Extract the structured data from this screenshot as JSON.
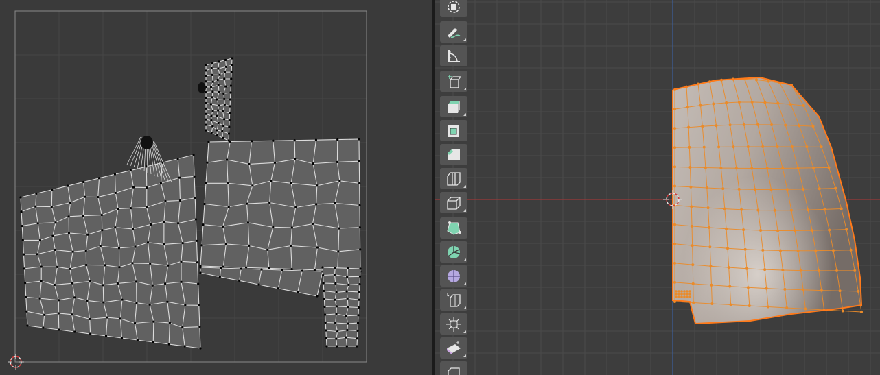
{
  "uv_editor": {
    "colors": {
      "background": "#3a3a3a",
      "grid": "#464646",
      "border": "#8a8a8a",
      "face": "#616161",
      "edge": "#dcdcdc",
      "vertex": "#000000"
    }
  },
  "viewport": {
    "colors": {
      "background": "#3d3d3d",
      "grid": "#4a4a4a",
      "x_axis": "#9b3a3a",
      "y_axis": "#3d5f9b",
      "mesh_face": "#b3a9a3",
      "mesh_edge": "#ea8b2a",
      "mesh_outline": "#ff7a1a"
    },
    "toolbar": {
      "tools": [
        {
          "name": "cursor-icon",
          "corner": false
        },
        {
          "name": "annotate-icon",
          "corner": true
        },
        {
          "name": "measure-icon",
          "corner": false
        },
        {
          "name": "add-cube-icon",
          "corner": true
        },
        {
          "name": "extrude-region-icon",
          "corner": true
        },
        {
          "name": "inset-faces-icon",
          "corner": false
        },
        {
          "name": "bevel-icon",
          "corner": false
        },
        {
          "name": "loop-cut-icon",
          "corner": true
        },
        {
          "name": "knife-icon",
          "corner": true
        },
        {
          "name": "poly-build-icon",
          "corner": false
        },
        {
          "name": "spin-icon",
          "corner": true
        },
        {
          "name": "smooth-icon",
          "corner": true
        },
        {
          "name": "edge-slide-icon",
          "corner": true
        },
        {
          "name": "shrink-fatten-icon",
          "corner": true
        },
        {
          "name": "shear-icon",
          "corner": true
        },
        {
          "name": "rip-region-icon",
          "corner": true
        }
      ]
    }
  }
}
